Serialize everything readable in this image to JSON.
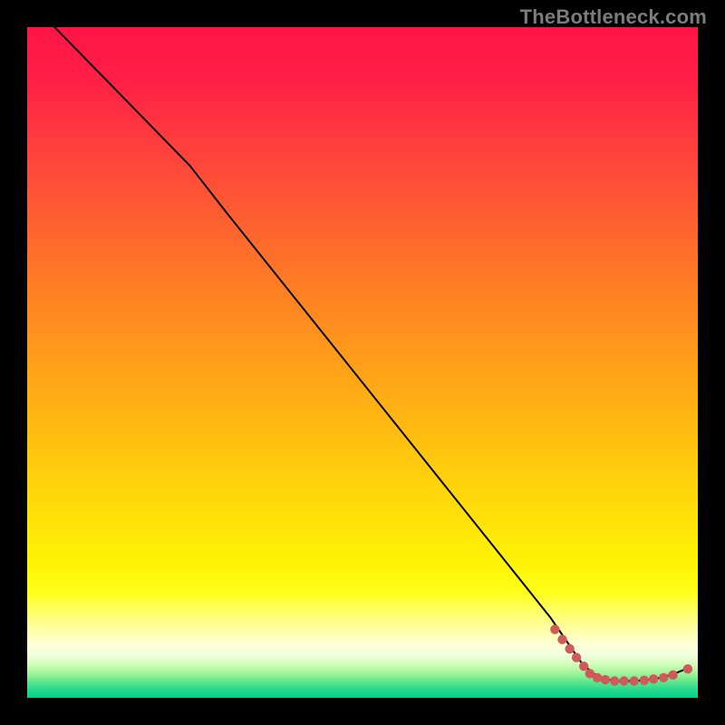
{
  "watermark": "TheBottleneck.com",
  "gradient_stops": [
    {
      "pos": 0.0,
      "color": "#ff1547"
    },
    {
      "pos": 0.08,
      "color": "#ff2045"
    },
    {
      "pos": 0.16,
      "color": "#ff3a3f"
    },
    {
      "pos": 0.24,
      "color": "#ff5236"
    },
    {
      "pos": 0.32,
      "color": "#ff6a2c"
    },
    {
      "pos": 0.4,
      "color": "#ff8223"
    },
    {
      "pos": 0.48,
      "color": "#ff991b"
    },
    {
      "pos": 0.56,
      "color": "#ffb014"
    },
    {
      "pos": 0.64,
      "color": "#ffc70e"
    },
    {
      "pos": 0.72,
      "color": "#ffde0a"
    },
    {
      "pos": 0.8,
      "color": "#fff406"
    },
    {
      "pos": 0.842,
      "color": "#ffff1a"
    },
    {
      "pos": 0.88,
      "color": "#ffff7d"
    },
    {
      "pos": 0.905,
      "color": "#ffffb6"
    },
    {
      "pos": 0.92,
      "color": "#ffffd6"
    },
    {
      "pos": 0.935,
      "color": "#f2ffdf"
    },
    {
      "pos": 0.948,
      "color": "#d8fec0"
    },
    {
      "pos": 0.958,
      "color": "#b6f9a4"
    },
    {
      "pos": 0.968,
      "color": "#8bef93"
    },
    {
      "pos": 0.978,
      "color": "#57e48e"
    },
    {
      "pos": 0.988,
      "color": "#25d98d"
    },
    {
      "pos": 1.0,
      "color": "#06ce8b"
    }
  ],
  "chart_data": {
    "type": "line",
    "title": "",
    "xlabel": "",
    "ylabel": "",
    "xlim": [
      0,
      100
    ],
    "ylim": [
      0,
      100
    ],
    "series": [
      {
        "name": "curve",
        "style": "line",
        "color": "#000000",
        "points": [
          {
            "x": 4.1,
            "y": 100.0
          },
          {
            "x": 24.3,
            "y": 79.3
          },
          {
            "x": 30.0,
            "y": 72.0
          },
          {
            "x": 78.0,
            "y": 12.0
          },
          {
            "x": 82.8,
            "y": 5.0
          },
          {
            "x": 85.0,
            "y": 3.2
          },
          {
            "x": 86.0,
            "y": 2.8
          },
          {
            "x": 88.0,
            "y": 2.5
          },
          {
            "x": 90.0,
            "y": 2.5
          },
          {
            "x": 92.0,
            "y": 2.6
          },
          {
            "x": 94.0,
            "y": 2.9
          },
          {
            "x": 96.0,
            "y": 3.4
          },
          {
            "x": 98.5,
            "y": 4.4
          }
        ]
      },
      {
        "name": "markers",
        "style": "points",
        "color": "#cf5a5a",
        "points": [
          {
            "x": 78.7,
            "y": 10.2
          },
          {
            "x": 79.8,
            "y": 8.7
          },
          {
            "x": 80.9,
            "y": 7.3
          },
          {
            "x": 81.9,
            "y": 6.0
          },
          {
            "x": 83.0,
            "y": 4.7
          },
          {
            "x": 83.9,
            "y": 3.6
          },
          {
            "x": 85.0,
            "y": 3.0
          },
          {
            "x": 86.2,
            "y": 2.7
          },
          {
            "x": 87.6,
            "y": 2.5
          },
          {
            "x": 89.0,
            "y": 2.5
          },
          {
            "x": 90.5,
            "y": 2.5
          },
          {
            "x": 92.0,
            "y": 2.6
          },
          {
            "x": 93.4,
            "y": 2.8
          },
          {
            "x": 94.9,
            "y": 3.0
          },
          {
            "x": 96.3,
            "y": 3.4
          },
          {
            "x": 98.5,
            "y": 4.3
          }
        ]
      }
    ]
  }
}
